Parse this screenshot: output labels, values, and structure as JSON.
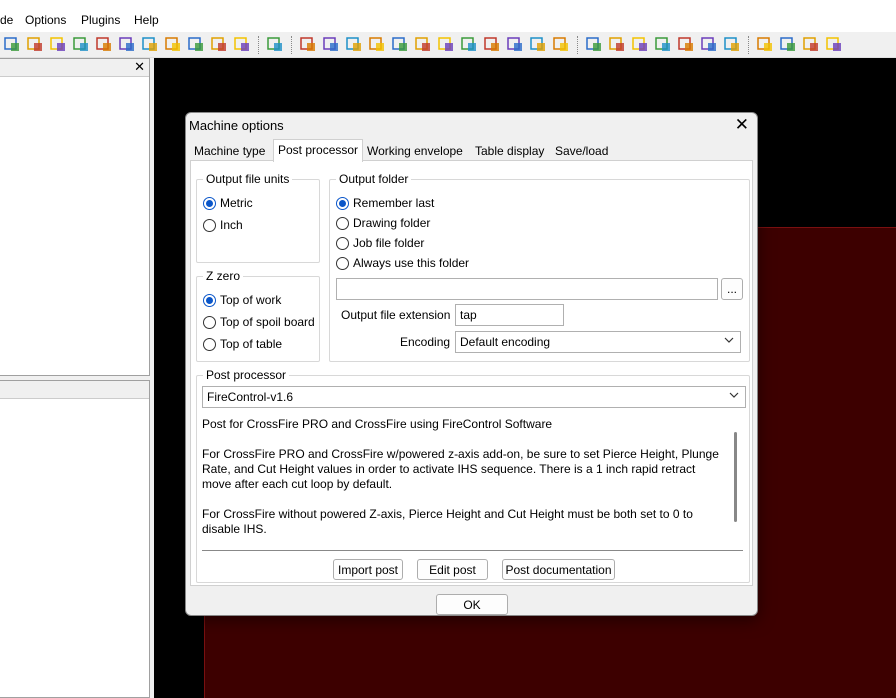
{
  "menubar": {
    "items": [
      "de",
      "Options",
      "Plugins",
      "Help"
    ]
  },
  "toolbar": {
    "icons": [
      "new-part-icon",
      "add-part-icon",
      "layer-icon",
      "stack-icon",
      "group-icon",
      "import-icon",
      "tool-icon",
      "wrench-icon",
      "cut-icon",
      "export-icon",
      "delete-icon",
      "undo-icon",
      "scissors-icon",
      "layers-icon",
      "window-icon",
      "copy-icon",
      "node-icon",
      "curve-icon",
      "offset-icon",
      "path-icon",
      "arrow-icon",
      "sheet-icon",
      "snap-icon",
      "frame-icon",
      "zoom-in-icon",
      "zoom-out-icon",
      "zoom-fit-icon",
      "zoom-window-icon",
      "zoom-extents-icon",
      "zoom-select-icon",
      "zoom-all-icon",
      "pointer-icon",
      "select-s-icon",
      "pen-icon",
      "script-icon"
    ]
  },
  "dialog": {
    "title": "Machine options",
    "close": "✕",
    "tabs": [
      "Machine type",
      "Post processor",
      "Working envelope",
      "Table display",
      "Save/load"
    ],
    "active_tab": "Post processor",
    "units": {
      "label": "Output file units",
      "options": [
        {
          "label": "Metric",
          "selected": true
        },
        {
          "label": "Inch",
          "selected": false
        }
      ]
    },
    "zzero": {
      "label": "Z zero",
      "options": [
        {
          "label": "Top of work",
          "selected": true
        },
        {
          "label": "Top of spoil board",
          "selected": false
        },
        {
          "label": "Top of table",
          "selected": false
        }
      ]
    },
    "output_folder": {
      "label": "Output folder",
      "options": [
        {
          "label": "Remember last",
          "selected": true
        },
        {
          "label": "Drawing folder",
          "selected": false
        },
        {
          "label": "Job file folder",
          "selected": false
        },
        {
          "label": "Always use this folder",
          "selected": false
        }
      ],
      "path_value": "",
      "browse_label": "...",
      "extension_label": "Output file extension",
      "extension_value": "tap",
      "encoding_label": "Encoding",
      "encoding_value": "Default encoding"
    },
    "post_processor": {
      "label": "Post processor",
      "selected": "FireControl-v1.6",
      "description": [
        "Post for CrossFire PRO and CrossFire using FireControl Software",
        "For CrossFire PRO and CrossFire w/powered z-axis add-on, be sure to set Pierce Height, Plunge Rate, and Cut Height values in order to activate IHS sequence. There is a 1 inch rapid retract move after each cut loop by default.",
        "For CrossFire without powered Z-axis, Pierce Height and Cut Height must be both set to 0 to disable IHS."
      ],
      "import_label": "Import post",
      "edit_label": "Edit post",
      "docs_label": "Post documentation"
    },
    "ok_label": "OK"
  },
  "left_panel": {
    "close": "✕"
  },
  "colors": {
    "accent": "#0a56c9",
    "canvas": "#000000",
    "table": "#3d0000"
  }
}
